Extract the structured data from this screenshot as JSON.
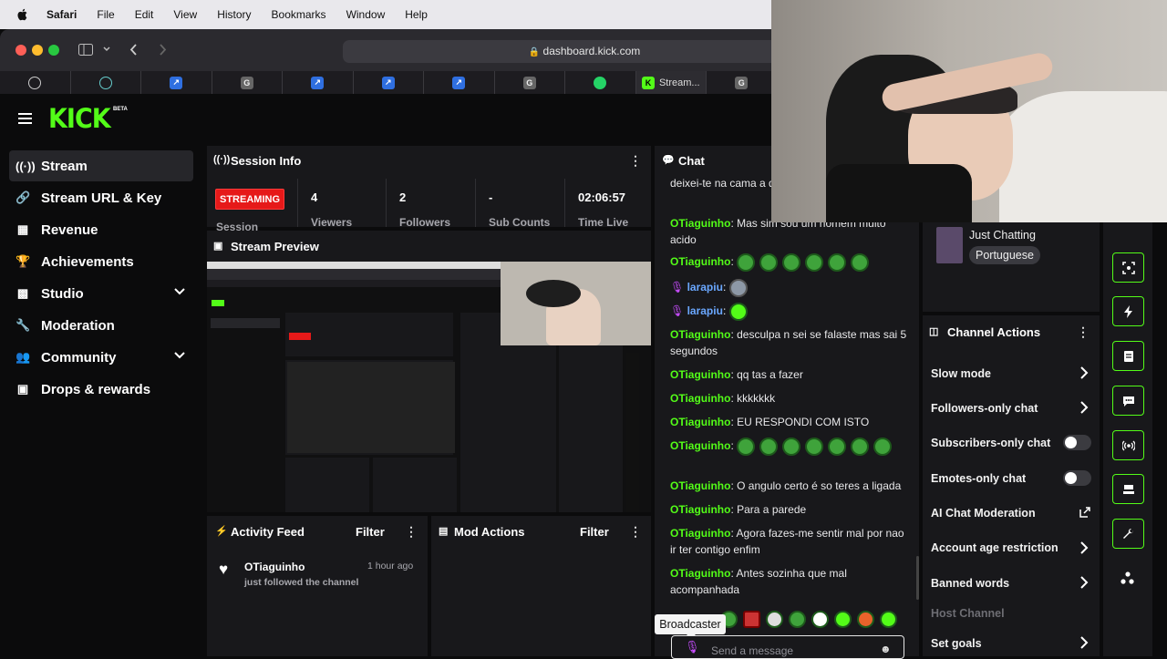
{
  "menubar": {
    "items": [
      "Safari",
      "File",
      "Edit",
      "View",
      "History",
      "Bookmarks",
      "Window",
      "Help"
    ]
  },
  "browser": {
    "url": "dashboard.kick.com",
    "tabs": [
      {
        "icon": "openai-icon",
        "label": ""
      },
      {
        "icon": "site-icon",
        "label": ""
      },
      {
        "icon": "blue-app-icon",
        "label": ""
      },
      {
        "icon": "g-icon",
        "label": ""
      },
      {
        "icon": "blue-app-icon",
        "label": ""
      },
      {
        "icon": "blue-app-icon",
        "label": ""
      },
      {
        "icon": "blue-app-icon",
        "label": ""
      },
      {
        "icon": "g-icon",
        "label": ""
      },
      {
        "icon": "whatsapp-icon",
        "label": ""
      },
      {
        "icon": "kick-icon",
        "label": "Stream..."
      },
      {
        "icon": "g-icon",
        "label": ""
      }
    ]
  },
  "app": {
    "logo": "KICK",
    "logo_badge": "BETA"
  },
  "sidebar": {
    "items": [
      {
        "label": "Stream",
        "icon": "broadcast-icon"
      },
      {
        "label": "Stream URL & Key",
        "icon": "link-icon"
      },
      {
        "label": "Revenue",
        "icon": "revenue-icon"
      },
      {
        "label": "Achievements",
        "icon": "trophy-icon"
      },
      {
        "label": "Studio",
        "icon": "studio-icon"
      },
      {
        "label": "Moderation",
        "icon": "wrench-icon"
      },
      {
        "label": "Community",
        "icon": "community-icon"
      },
      {
        "label": "Drops & rewards",
        "icon": "drops-icon"
      }
    ]
  },
  "session": {
    "title": "Session Info",
    "status": "STREAMING",
    "status_sub": "Session",
    "stats": [
      {
        "value": "4",
        "label": "Viewers"
      },
      {
        "value": "2",
        "label": "Followers"
      },
      {
        "value": "-",
        "label": "Sub Counts"
      },
      {
        "value": "02:06:57",
        "label": "Time Live"
      }
    ]
  },
  "preview": {
    "title": "Stream Preview"
  },
  "activity": {
    "title": "Activity Feed",
    "filter": "Filter",
    "items": [
      {
        "user": "OTiaguinho",
        "time": "1 hour ago",
        "text": "just followed the channel"
      }
    ]
  },
  "mod_actions": {
    "title": "Mod Actions",
    "filter": "Filter"
  },
  "chat": {
    "title": "Chat",
    "messages": [
      {
        "user": "",
        "text": "deixei-te na cama a d... apagei-te a luz"
      },
      {
        "user": "OTiaguinho",
        "text": "Mas sim sou um homem muito acido"
      },
      {
        "user": "OTiaguinho",
        "text": "",
        "emotes": 6
      },
      {
        "user": "larapiu",
        "text": "",
        "emotes": 1
      },
      {
        "user": "larapiu",
        "text": "",
        "emotes": 1
      },
      {
        "user": "OTiaguinho",
        "text": "desculpa n sei se falaste mas sai 5 segundos"
      },
      {
        "user": "OTiaguinho",
        "text": "qq tas a fazer"
      },
      {
        "user": "OTiaguinho",
        "text": "kkkkkkk"
      },
      {
        "user": "OTiaguinho",
        "text": "EU RESPONDI COM ISTO"
      },
      {
        "user": "OTiaguinho",
        "text": "",
        "emotes": 7
      },
      {
        "user": "OTiaguinho",
        "text": "O angulo certo é so teres a ligada"
      },
      {
        "user": "OTiaguinho",
        "text": "Para a parede"
      },
      {
        "user": "OTiaguinho",
        "text": "Agora fazes-me sentir mal por nao ir ter contigo enfim"
      },
      {
        "user": "OTiaguinho",
        "text": "Antes sozinha que mal acompanhada"
      }
    ],
    "tooltip": "Broadcaster",
    "input_placeholder": "Send a message"
  },
  "stream_meta": {
    "category": "Just Chatting",
    "language": "Portuguese"
  },
  "channel_actions": {
    "title": "Channel Actions",
    "items": [
      {
        "label": "Slow mode",
        "control": "chevron"
      },
      {
        "label": "Followers-only chat",
        "control": "chevron"
      },
      {
        "label": "Subscribers-only chat",
        "control": "toggle",
        "on": false
      },
      {
        "label": "Emotes-only chat",
        "control": "toggle",
        "on": false
      },
      {
        "label": "AI Chat Moderation",
        "control": "external"
      },
      {
        "label": "Account age restriction",
        "control": "chevron"
      },
      {
        "label": "Banned words",
        "control": "chevron"
      },
      {
        "label": "Host Channel",
        "control": "none",
        "disabled": true
      },
      {
        "label": "Set goals",
        "control": "chevron"
      }
    ]
  },
  "right_rail": {
    "buttons": [
      "screenshot-icon",
      "lightning-icon",
      "notes-icon",
      "chat-bubble-icon",
      "broadcast-icon",
      "video-icon",
      "wrench-icon",
      "more-dots-icon"
    ]
  },
  "colors": {
    "brand": "#53fc18",
    "panel": "#18181b",
    "background": "#0b0b0c",
    "live": "#e61919",
    "username_alt": "#6aa7ff"
  }
}
